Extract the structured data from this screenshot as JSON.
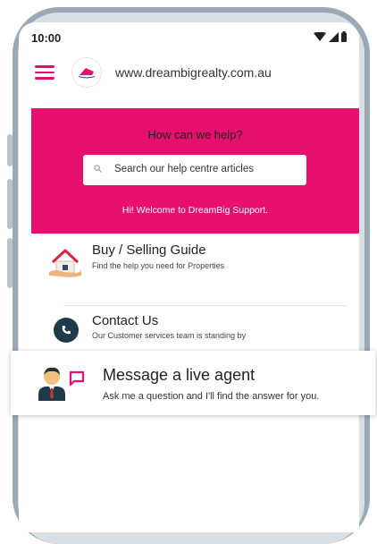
{
  "statusbar": {
    "time": "10:00"
  },
  "browser": {
    "url": "www.dreambigrealty.com.au"
  },
  "hero": {
    "title": "How can we help?",
    "search_placeholder": "Search our help centre articles",
    "welcome": "Hi! Welcome to DreamBig Support."
  },
  "items": [
    {
      "title": "Buy / Selling Guide",
      "subtitle": "Find the help you need for Properties",
      "icon": "house-hand-icon"
    },
    {
      "title": "Contact Us",
      "subtitle": "Our Customer services team is standing by",
      "icon": "phone-icon"
    }
  ],
  "live_agent": {
    "title": "Message a live agent",
    "subtitle": "Ask me a question and I'll find the answer for you.",
    "icons": [
      "agent-avatar-icon",
      "chat-bubble-icon"
    ]
  },
  "colors": {
    "brand": "#e8106f",
    "frame": "#9aa9b5",
    "contact_icon_bg": "#1f3a4a"
  }
}
